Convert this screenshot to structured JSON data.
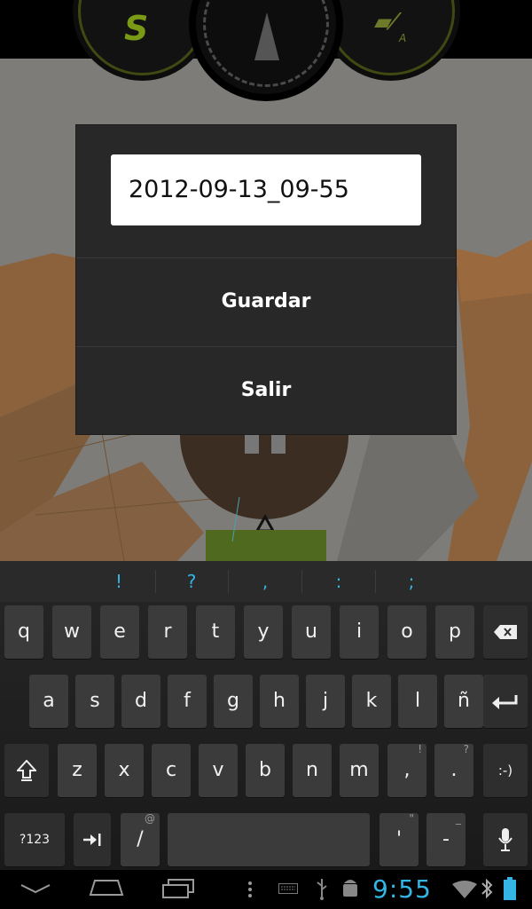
{
  "dialog": {
    "filename_value": "2012-09-13_09-55",
    "save_label": "Guardar",
    "exit_label": "Salir"
  },
  "hud": {
    "left_label": "S",
    "right_label": "A"
  },
  "keyboard": {
    "suggestions": [
      "!",
      "?",
      ",",
      ":",
      ";"
    ],
    "row1": [
      "q",
      "w",
      "e",
      "r",
      "t",
      "y",
      "u",
      "i",
      "o",
      "p"
    ],
    "row2": [
      "a",
      "s",
      "d",
      "f",
      "g",
      "h",
      "j",
      "k",
      "l",
      "ñ"
    ],
    "row3": [
      "z",
      "x",
      "c",
      "v",
      "b",
      "n",
      "m"
    ],
    "row3_extra": {
      "comma": ",",
      "comma_hint": "!",
      "period": ".",
      "period_hint": "?",
      "smiley": ":-)"
    },
    "row4": {
      "symbols": "?123",
      "slash": "/",
      "slash_hint": "@",
      "apostrophe": "'",
      "apos_hint": "\"",
      "dash": "-",
      "dash_hint": "_"
    }
  },
  "status": {
    "time": "9:55"
  },
  "colors": {
    "accent": "#33b5e5",
    "dialog_bg": "#282828",
    "key_bg": "#3b3b3b"
  },
  "icons": [
    "backspace-icon",
    "enter-icon",
    "shift-icon",
    "tab-icon",
    "mic-icon",
    "back-icon",
    "home-icon",
    "recents-icon",
    "menu-icon",
    "keyboard-icon",
    "usb-icon",
    "android-debug-icon",
    "wifi-icon",
    "bluetooth-icon",
    "battery-icon"
  ]
}
